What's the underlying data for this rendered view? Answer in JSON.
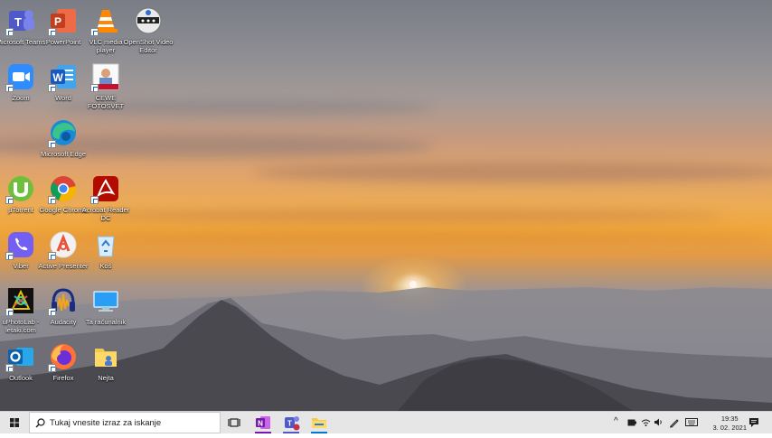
{
  "desktop_icons": [
    {
      "label": "Microsoft Teams",
      "icon": "teams-icon"
    },
    {
      "label": "PowerPoint",
      "icon": "powerpoint-icon"
    },
    {
      "label": "VLC media player",
      "icon": "vlc-icon"
    },
    {
      "label": "OpenShot Video Editor",
      "icon": "openshot-icon"
    },
    {
      "label": "Zoom",
      "icon": "zoom-icon"
    },
    {
      "label": "Word",
      "icon": "word-icon"
    },
    {
      "label": "CEWE FOTOSVET",
      "icon": "cewe-icon"
    },
    {
      "label": "Microsoft Edge",
      "icon": "edge-icon"
    },
    {
      "label": "µTorrent",
      "icon": "utorrent-icon"
    },
    {
      "label": "Google Chrome",
      "icon": "chrome-icon"
    },
    {
      "label": "Acrobat Reader DC",
      "icon": "acrobat-icon"
    },
    {
      "label": "Viber",
      "icon": "viber-icon"
    },
    {
      "label": "Active Presenter",
      "icon": "activepresenter-icon"
    },
    {
      "label": "Koš",
      "icon": "recycle-bin-icon"
    },
    {
      "label": "uPhotoLab - letaki.com",
      "icon": "uphotolab-icon"
    },
    {
      "label": "Audacity",
      "icon": "audacity-icon"
    },
    {
      "label": "Ta računalnik",
      "icon": "this-pc-icon"
    },
    {
      "label": "Outlook",
      "icon": "outlook-icon"
    },
    {
      "label": "Firefox",
      "icon": "firefox-icon"
    },
    {
      "label": "Nejta",
      "icon": "folder-icon"
    }
  ],
  "taskbar": {
    "search_placeholder": "Tukaj vnesite izraz za iskanje",
    "pinned_apps": [
      "onenote-icon",
      "teams-icon",
      "file-explorer-icon"
    ],
    "tray": {
      "time": "19:35",
      "date": "3. 02. 2021"
    }
  },
  "colors": {
    "taskbar_bg": "#e6e6e6",
    "accent": "#0078d4"
  }
}
